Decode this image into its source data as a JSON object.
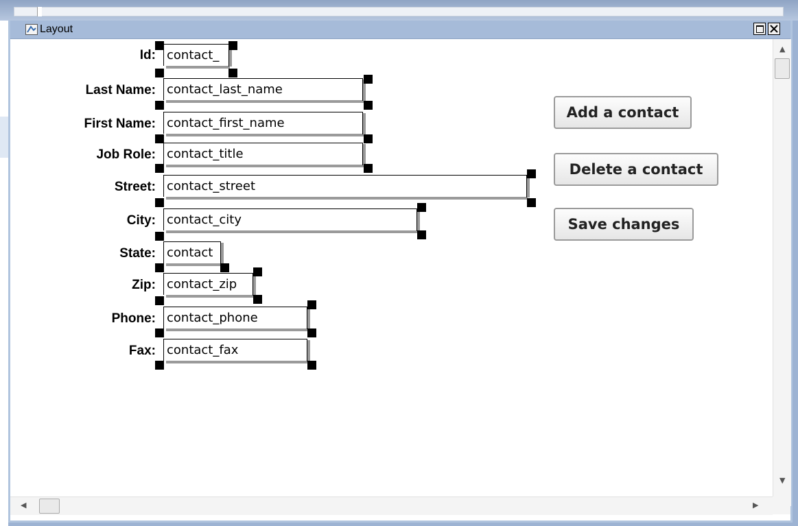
{
  "window": {
    "title": "Layout"
  },
  "form": {
    "fields": [
      {
        "label": "Id:",
        "value": "contact_"
      },
      {
        "label": "Last Name:",
        "value": "contact_last_name"
      },
      {
        "label": "First Name:",
        "value": "contact_first_name"
      },
      {
        "label": "Job Role:",
        "value": "contact_title"
      },
      {
        "label": "Street:",
        "value": "contact_street"
      },
      {
        "label": "City:",
        "value": "contact_city"
      },
      {
        "label": "State:",
        "value": "contact"
      },
      {
        "label": "Zip:",
        "value": "contact_zip"
      },
      {
        "label": "Phone:",
        "value": "contact_phone"
      },
      {
        "label": "Fax:",
        "value": "contact_fax"
      }
    ]
  },
  "buttons": {
    "add": "Add a contact",
    "delete": "Delete a contact",
    "save": "Save changes"
  },
  "colors": {
    "titlebar": "#a6bbd9",
    "frame": "#9db3d3",
    "handle": "#000000"
  }
}
